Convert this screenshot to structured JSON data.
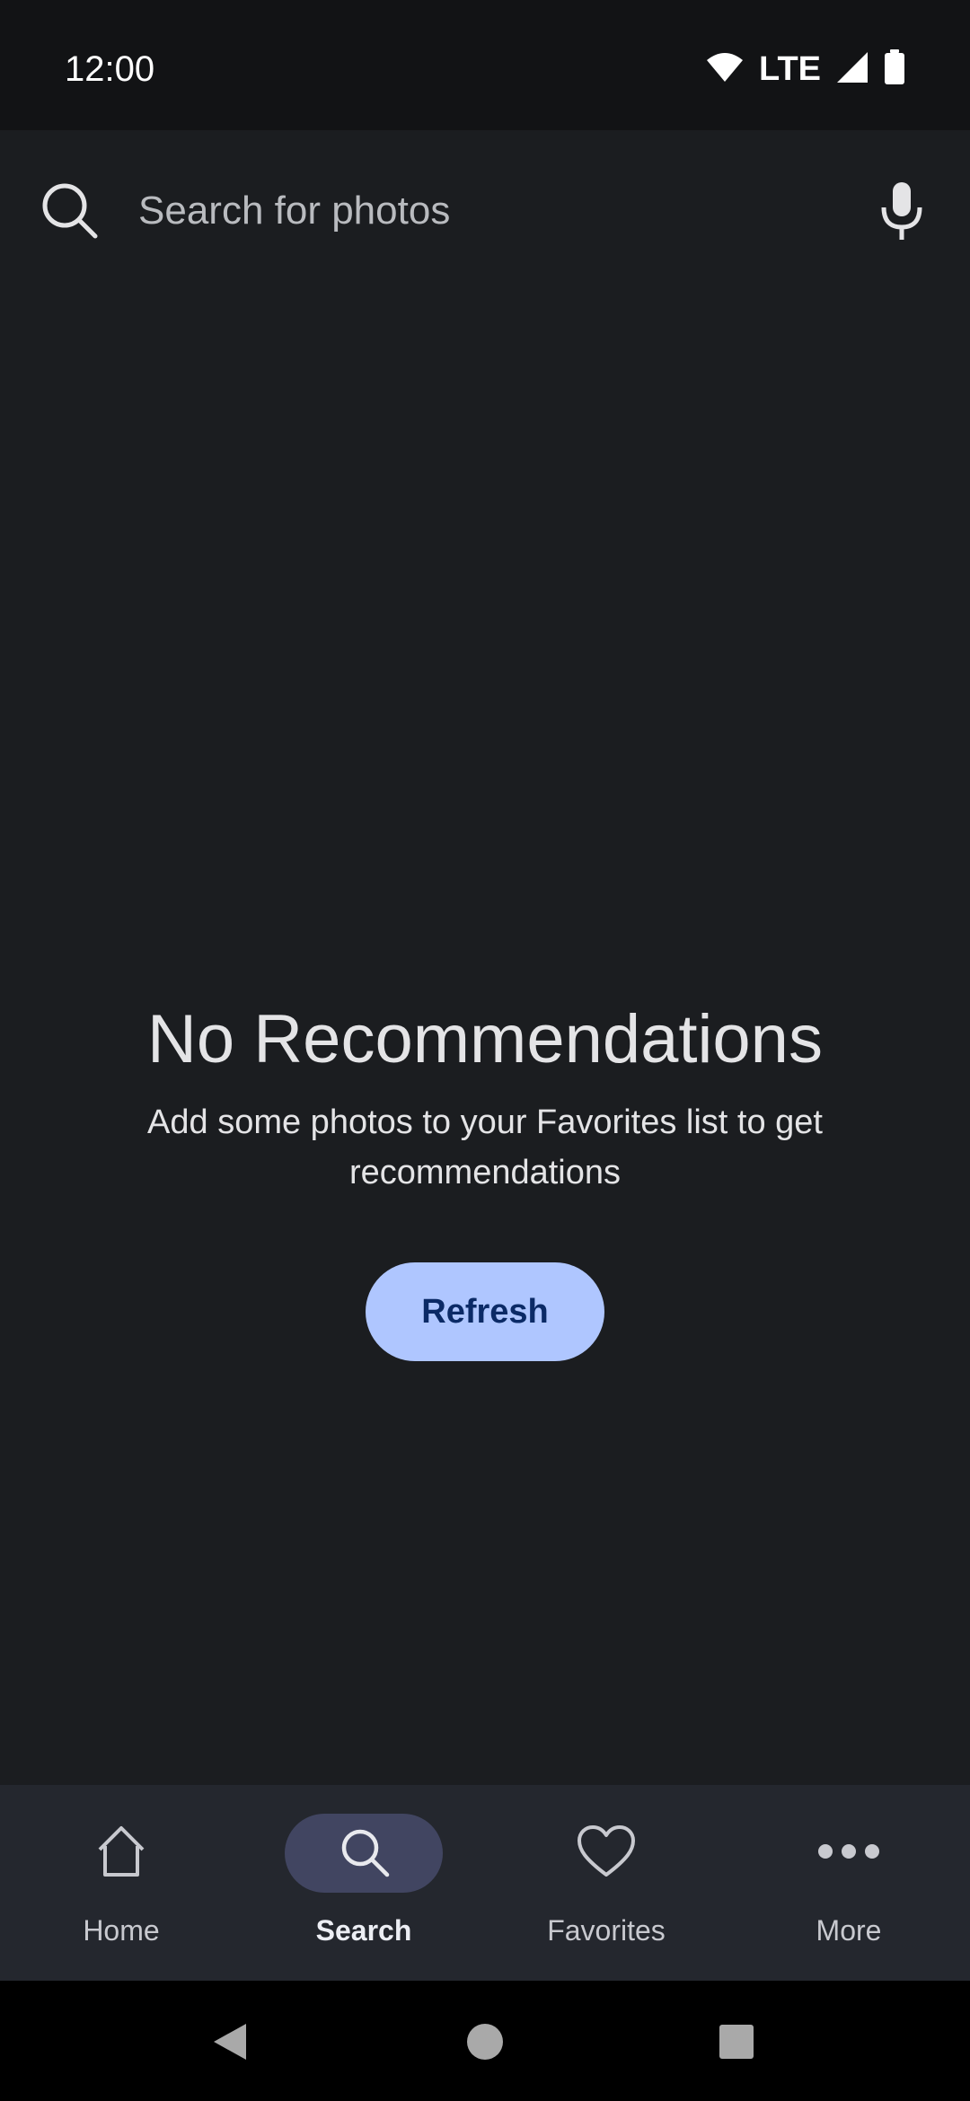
{
  "status_bar": {
    "time": "12:00",
    "network": "LTE"
  },
  "search": {
    "placeholder": "Search for photos",
    "value": ""
  },
  "empty_state": {
    "title": "No Recommendations",
    "subtitle": "Add some photos to your Favorites list to get recommendations",
    "button_label": "Refresh"
  },
  "bottom_nav": {
    "items": [
      {
        "label": "Home",
        "icon": "home-icon",
        "active": false
      },
      {
        "label": "Search",
        "icon": "search-icon",
        "active": true
      },
      {
        "label": "Favorites",
        "icon": "heart-icon",
        "active": false
      },
      {
        "label": "More",
        "icon": "more-horizontal-icon",
        "active": false
      }
    ]
  },
  "colors": {
    "background": "#1b1d20",
    "status_bar": "#121315",
    "nav_bar": "#24272e",
    "active_indicator": "#414561",
    "button_bg": "#afc6ff",
    "button_text": "#0b2a66"
  }
}
